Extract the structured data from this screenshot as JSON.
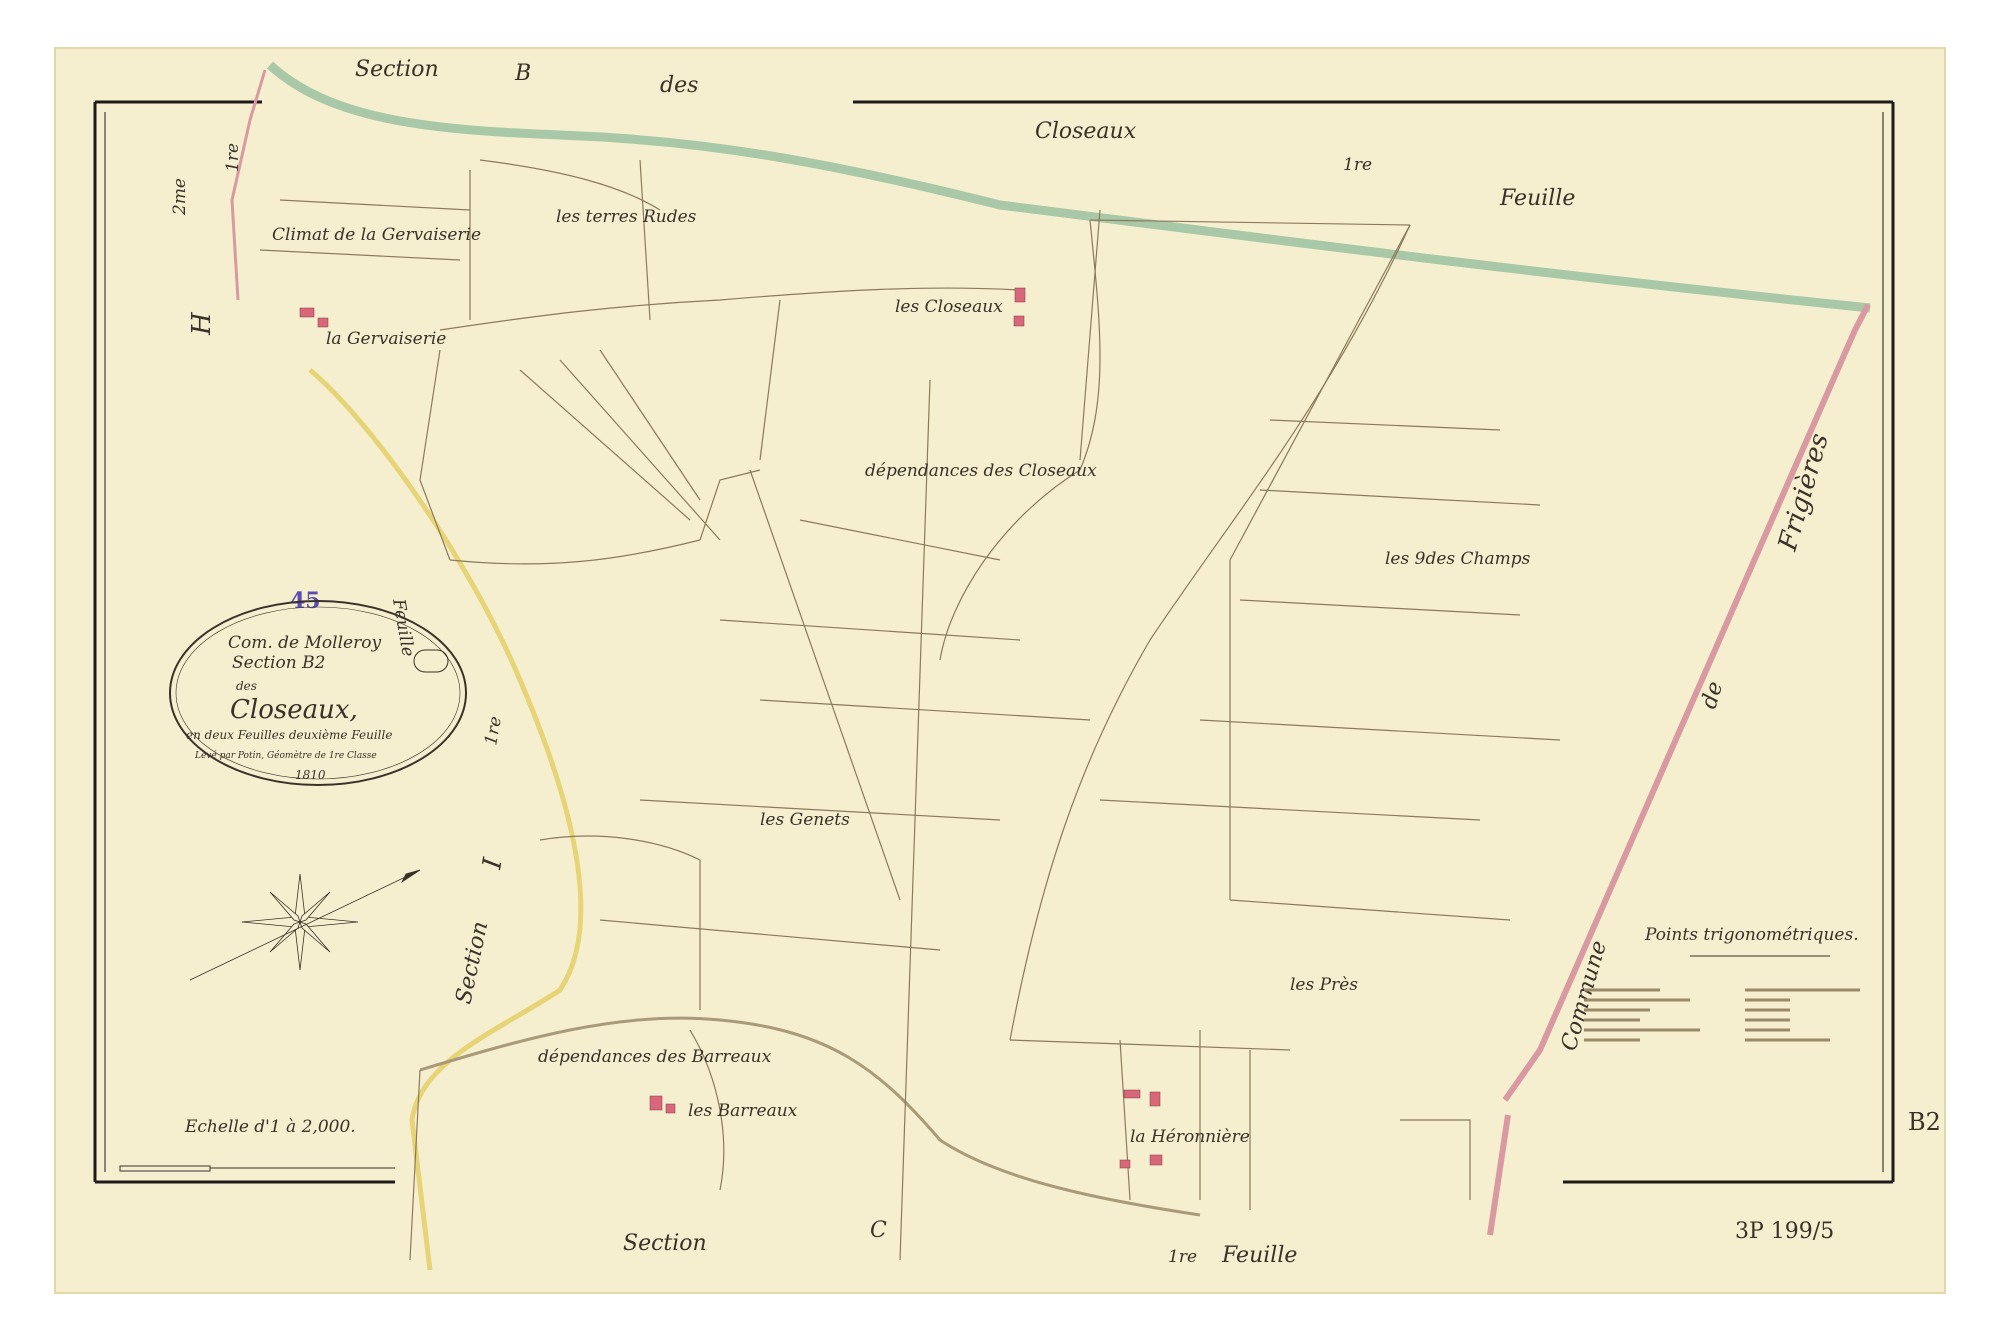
{
  "map": {
    "section_top": "Section",
    "section_top_letter": "B",
    "des_top": "des",
    "closeaux_top": "Closeaux",
    "feuille_top_num": "1re",
    "feuille_top": "Feuille",
    "section_left_letter": "H",
    "section_left_num": "2me",
    "section_left_num2": "1re",
    "section_left_feuille": "Feuille",
    "section_left_I": "I",
    "section_left_word": "Section",
    "section_left_I_num": "1re",
    "section_bottom": "Section",
    "section_bottom_letter": "C",
    "feuille_bottom_num": "1re",
    "feuille_bottom": "Feuille",
    "commune": "Commune",
    "de": "de",
    "frigieres": "Frigières",
    "places": [
      {
        "name": "Climat de la Gervaiserie"
      },
      {
        "name": "la Gervaiserie"
      },
      {
        "name": "les terres Rudes"
      },
      {
        "name": "les Closeaux"
      },
      {
        "name": "dépendances des Closeaux"
      },
      {
        "name": "les 9des Champs"
      },
      {
        "name": "les Genets"
      },
      {
        "name": "les Près"
      },
      {
        "name": "dépendances des Barreaux"
      },
      {
        "name": "les Barreaux"
      },
      {
        "name": "la Héronnière"
      }
    ],
    "stamp_number": "45",
    "cartouche": {
      "line1": "Com. de Molleroy",
      "line2": "Section B2",
      "line3": "des",
      "title": "Closeaux,",
      "line5": "en deux Feuilles deuxième Feuille",
      "line6": "Levé par Potin, Géomètre de 1re Classe",
      "year": "1810"
    },
    "scale_label": "Echelle d'1 à 2,000.",
    "trig_title": "Points trigonométriques.",
    "archive_ref": "3P 199/5",
    "sheet_mark": "B2",
    "colors": {
      "paper": "#f5efd0",
      "paper_edge": "#ece3bd",
      "border": "#1d1a17",
      "parcel": "#8a7a5a",
      "road_green": "#a8c8a8",
      "road_pink": "#d89aa0",
      "road_yellow": "#e6d476",
      "house": "#d9677a",
      "stamp": "#5a4fb0"
    }
  }
}
